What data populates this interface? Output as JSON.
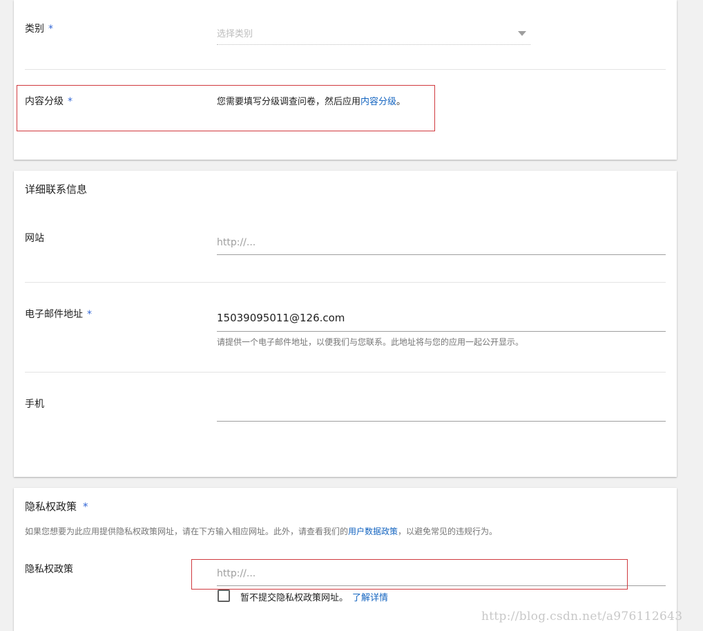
{
  "category": {
    "label": "类别",
    "required": "*",
    "placeholder": "选择类别",
    "dropdown_icon": "triangle-down-icon"
  },
  "content_rating": {
    "label": "内容分级",
    "required": "*",
    "text_prefix": "您需要填写分级调查问卷，然后应用",
    "link": "内容分级",
    "text_suffix": "。"
  },
  "contact": {
    "title": "详细联系信息",
    "website": {
      "label": "网站",
      "placeholder": "http://..."
    },
    "email": {
      "label": "电子邮件地址",
      "required": "*",
      "value": "15039095011@126.com",
      "helper": "请提供一个电子邮件地址，以便我们与您联系。此地址将与您的应用一起公开显示。"
    },
    "phone": {
      "label": "手机",
      "value": ""
    }
  },
  "privacy": {
    "title": "隐私权政策",
    "required": "*",
    "desc_prefix": "如果您想要为此应用提供隐私权政策网址，请在下方输入相应网址。此外，请查看我们的",
    "desc_link": "用户数据政策",
    "desc_suffix": "，以避免常见的违规行为。",
    "field_label": "隐私权政策",
    "placeholder": "http://...",
    "checkbox_label": "暂不提交隐私权政策网址。",
    "learn_more": "了解详情"
  },
  "watermark": "http://blog.csdn.net/a976112643"
}
